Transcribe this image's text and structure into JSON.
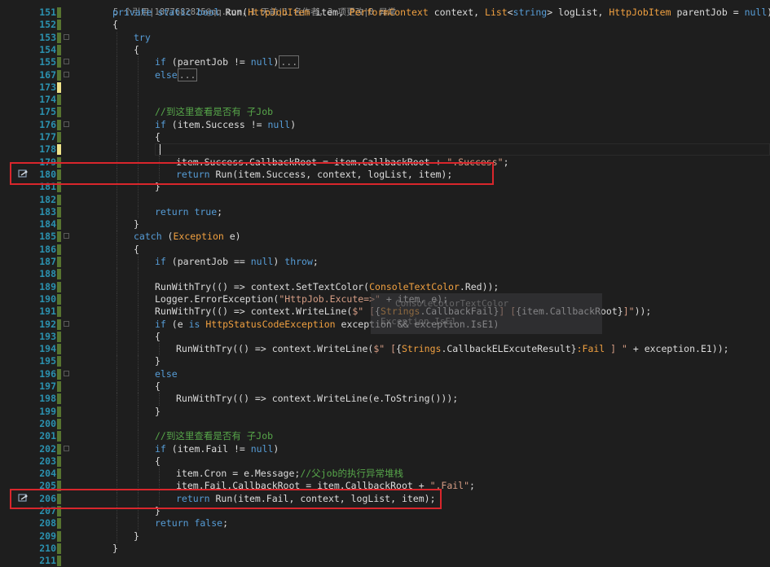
{
  "editor": {
    "codelens": "5 个引用|1877682825@qq.com，1 天前|1 名作者，3 项更改|0 异常",
    "tooltip_lines": [
      "ConsoleColorTextColor",
      "Exception.IsE1"
    ],
    "lines": [
      {
        "n": "151",
        "indent": 2,
        "change": "saved",
        "fold": false,
        "tokens": [
          [
            "kw",
            "private static bool "
          ],
          [
            "id",
            "Run("
          ],
          [
            "ty",
            "HttpJobItem"
          ],
          [
            "id",
            " item, "
          ],
          [
            "ty",
            "PerformContext"
          ],
          [
            "id",
            " context, "
          ],
          [
            "ty",
            "List"
          ],
          [
            "id",
            "<"
          ],
          [
            "kw",
            "string"
          ],
          [
            "id",
            "> logList, "
          ],
          [
            "ty",
            "HttpJobItem"
          ],
          [
            "id",
            " parentJob = "
          ],
          [
            "kw",
            "null"
          ],
          [
            "id",
            ")"
          ]
        ]
      },
      {
        "n": "152",
        "indent": 2,
        "change": "saved",
        "tokens": [
          [
            "id",
            "{"
          ]
        ]
      },
      {
        "n": "153",
        "indent": 3,
        "change": "saved",
        "fold": true,
        "tokens": [
          [
            "kw",
            "try"
          ]
        ]
      },
      {
        "n": "154",
        "indent": 3,
        "change": "saved",
        "tokens": [
          [
            "id",
            "{"
          ]
        ]
      },
      {
        "n": "155",
        "indent": 4,
        "change": "saved",
        "fold": true,
        "tokens": [
          [
            "kw",
            "if"
          ],
          [
            "id",
            " (parentJob != "
          ],
          [
            "kw",
            "null"
          ],
          [
            "id",
            ")"
          ],
          [
            "collapsed",
            "..."
          ]
        ]
      },
      {
        "n": "167",
        "indent": 4,
        "change": "saved",
        "fold": true,
        "tokens": [
          [
            "kw",
            "else"
          ],
          [
            "collapsed",
            "..."
          ]
        ]
      },
      {
        "n": "173",
        "indent": 4,
        "change": "unsaved",
        "tokens": []
      },
      {
        "n": "174",
        "indent": 4,
        "change": "saved",
        "tokens": []
      },
      {
        "n": "175",
        "indent": 4,
        "change": "saved",
        "tokens": [
          [
            "cm",
            "//到这里查看是否有 子Job"
          ]
        ]
      },
      {
        "n": "176",
        "indent": 4,
        "change": "saved",
        "fold": true,
        "tokens": [
          [
            "kw",
            "if"
          ],
          [
            "id",
            " (item.Success != "
          ],
          [
            "kw",
            "null"
          ],
          [
            "id",
            ")"
          ]
        ]
      },
      {
        "n": "177",
        "indent": 4,
        "change": "saved",
        "tokens": [
          [
            "id",
            "{"
          ]
        ]
      },
      {
        "n": "178",
        "indent": 5,
        "change": "unsaved",
        "tokens": []
      },
      {
        "n": "179",
        "indent": 5,
        "change": "saved",
        "tokens": [
          [
            "id",
            "item.Success.CallbackRoot = item.CallbackRoot + "
          ],
          [
            "str",
            "\".Success\""
          ],
          [
            "id",
            ";"
          ]
        ]
      },
      {
        "n": "180",
        "indent": 5,
        "change": "saved",
        "tokens": [
          [
            "kw",
            "return"
          ],
          [
            "id",
            " Run(item.Success, context, logList, item);"
          ]
        ]
      },
      {
        "n": "181",
        "indent": 4,
        "change": "saved",
        "tokens": [
          [
            "id",
            "}"
          ]
        ]
      },
      {
        "n": "182",
        "indent": 4,
        "change": "saved",
        "tokens": []
      },
      {
        "n": "183",
        "indent": 4,
        "change": "saved",
        "tokens": [
          [
            "kw",
            "return true"
          ],
          [
            "id",
            ";"
          ]
        ]
      },
      {
        "n": "184",
        "indent": 3,
        "change": "saved",
        "tokens": [
          [
            "id",
            "}"
          ]
        ]
      },
      {
        "n": "185",
        "indent": 3,
        "change": "saved",
        "fold": true,
        "tokens": [
          [
            "kw",
            "catch"
          ],
          [
            "id",
            " ("
          ],
          [
            "ty",
            "Exception"
          ],
          [
            "id",
            " e)"
          ]
        ]
      },
      {
        "n": "186",
        "indent": 3,
        "change": "saved",
        "tokens": [
          [
            "id",
            "{"
          ]
        ]
      },
      {
        "n": "187",
        "indent": 4,
        "change": "saved",
        "tokens": [
          [
            "kw",
            "if"
          ],
          [
            "id",
            " (parentJob == "
          ],
          [
            "kw",
            "null"
          ],
          [
            "id",
            ") "
          ],
          [
            "kw",
            "throw"
          ],
          [
            "id",
            ";"
          ]
        ]
      },
      {
        "n": "188",
        "indent": 4,
        "change": "saved",
        "tokens": []
      },
      {
        "n": "189",
        "indent": 4,
        "change": "saved",
        "tokens": [
          [
            "id",
            "RunWithTry(() => context.SetTextColor("
          ],
          [
            "ty",
            "ConsoleTextColor"
          ],
          [
            "id",
            ".Red));"
          ]
        ]
      },
      {
        "n": "190",
        "indent": 4,
        "change": "saved",
        "tokens": [
          [
            "id",
            "Logger.ErrorException("
          ],
          [
            "str",
            "\"HttpJob.Excute=>\""
          ],
          [
            "id",
            " + item, e);"
          ]
        ]
      },
      {
        "n": "191",
        "indent": 4,
        "change": "saved",
        "tokens": [
          [
            "id",
            "RunWithTry(() => context.WriteLine("
          ],
          [
            "str",
            "$\" ["
          ],
          [
            "id",
            "{"
          ],
          [
            "ty",
            "Strings"
          ],
          [
            "id",
            ".CallbackFail}"
          ],
          [
            "str",
            "] ["
          ],
          [
            "id",
            "{item.CallbackRoot}"
          ],
          [
            "str",
            "]\""
          ],
          [
            "id",
            "));"
          ]
        ]
      },
      {
        "n": "192",
        "indent": 4,
        "change": "saved",
        "fold": true,
        "tokens": [
          [
            "kw",
            "if"
          ],
          [
            "id",
            " (e "
          ],
          [
            "kw",
            "is"
          ],
          [
            "id",
            " "
          ],
          [
            "ty",
            "HttpStatusCodeException"
          ],
          [
            "id",
            " exception && exception.IsE1)"
          ]
        ]
      },
      {
        "n": "193",
        "indent": 4,
        "change": "saved",
        "tokens": [
          [
            "id",
            "{"
          ]
        ]
      },
      {
        "n": "194",
        "indent": 5,
        "change": "saved",
        "tokens": [
          [
            "id",
            "RunWithTry(() => context.WriteLine("
          ],
          [
            "str",
            "$\" ["
          ],
          [
            "id",
            "{"
          ],
          [
            "ty",
            "Strings"
          ],
          [
            "id",
            ".CallbackELExcuteResult}"
          ],
          [
            "ty",
            ":Fail"
          ],
          [
            "str",
            " ] \""
          ],
          [
            "id",
            " + exception.E1));"
          ]
        ]
      },
      {
        "n": "195",
        "indent": 4,
        "change": "saved",
        "tokens": [
          [
            "id",
            "}"
          ]
        ]
      },
      {
        "n": "196",
        "indent": 4,
        "change": "saved",
        "fold": true,
        "tokens": [
          [
            "kw",
            "else"
          ]
        ]
      },
      {
        "n": "197",
        "indent": 4,
        "change": "saved",
        "tokens": [
          [
            "id",
            "{"
          ]
        ]
      },
      {
        "n": "198",
        "indent": 5,
        "change": "saved",
        "tokens": [
          [
            "id",
            "RunWithTry(() => context.WriteLine(e.ToString()));"
          ]
        ]
      },
      {
        "n": "199",
        "indent": 4,
        "change": "saved",
        "tokens": [
          [
            "id",
            "}"
          ]
        ]
      },
      {
        "n": "200",
        "indent": 4,
        "change": "saved",
        "tokens": []
      },
      {
        "n": "201",
        "indent": 4,
        "change": "saved",
        "tokens": [
          [
            "cm",
            "//到这里查看是否有 子Job"
          ]
        ]
      },
      {
        "n": "202",
        "indent": 4,
        "change": "saved",
        "fold": true,
        "tokens": [
          [
            "kw",
            "if"
          ],
          [
            "id",
            " (item.Fail != "
          ],
          [
            "kw",
            "null"
          ],
          [
            "id",
            ")"
          ]
        ]
      },
      {
        "n": "203",
        "indent": 4,
        "change": "saved",
        "tokens": [
          [
            "id",
            "{"
          ]
        ]
      },
      {
        "n": "204",
        "indent": 5,
        "change": "saved",
        "tokens": [
          [
            "id",
            "item.Cron = e.Message;"
          ],
          [
            "cm",
            "//父job的执行异常堆栈"
          ]
        ]
      },
      {
        "n": "205",
        "indent": 5,
        "change": "saved",
        "tokens": [
          [
            "id",
            "item.Fail.CallbackRoot = item.CallbackRoot + "
          ],
          [
            "str",
            "\".Fail\""
          ],
          [
            "id",
            ";"
          ]
        ]
      },
      {
        "n": "206",
        "indent": 5,
        "change": "saved",
        "tokens": [
          [
            "kw",
            "return"
          ],
          [
            "id",
            " Run(item.Fail, context, logList, item);"
          ]
        ]
      },
      {
        "n": "207",
        "indent": 4,
        "change": "saved",
        "tokens": [
          [
            "id",
            "}"
          ]
        ]
      },
      {
        "n": "208",
        "indent": 4,
        "change": "saved",
        "tokens": [
          [
            "kw",
            "return false"
          ],
          [
            "id",
            ";"
          ]
        ]
      },
      {
        "n": "209",
        "indent": 3,
        "change": "saved",
        "tokens": [
          [
            "id",
            "}"
          ]
        ]
      },
      {
        "n": "210",
        "indent": 2,
        "change": "saved",
        "tokens": [
          [
            "id",
            "}"
          ]
        ]
      },
      {
        "n": "211",
        "indent": 2,
        "change": "saved",
        "tokens": []
      }
    ]
  }
}
